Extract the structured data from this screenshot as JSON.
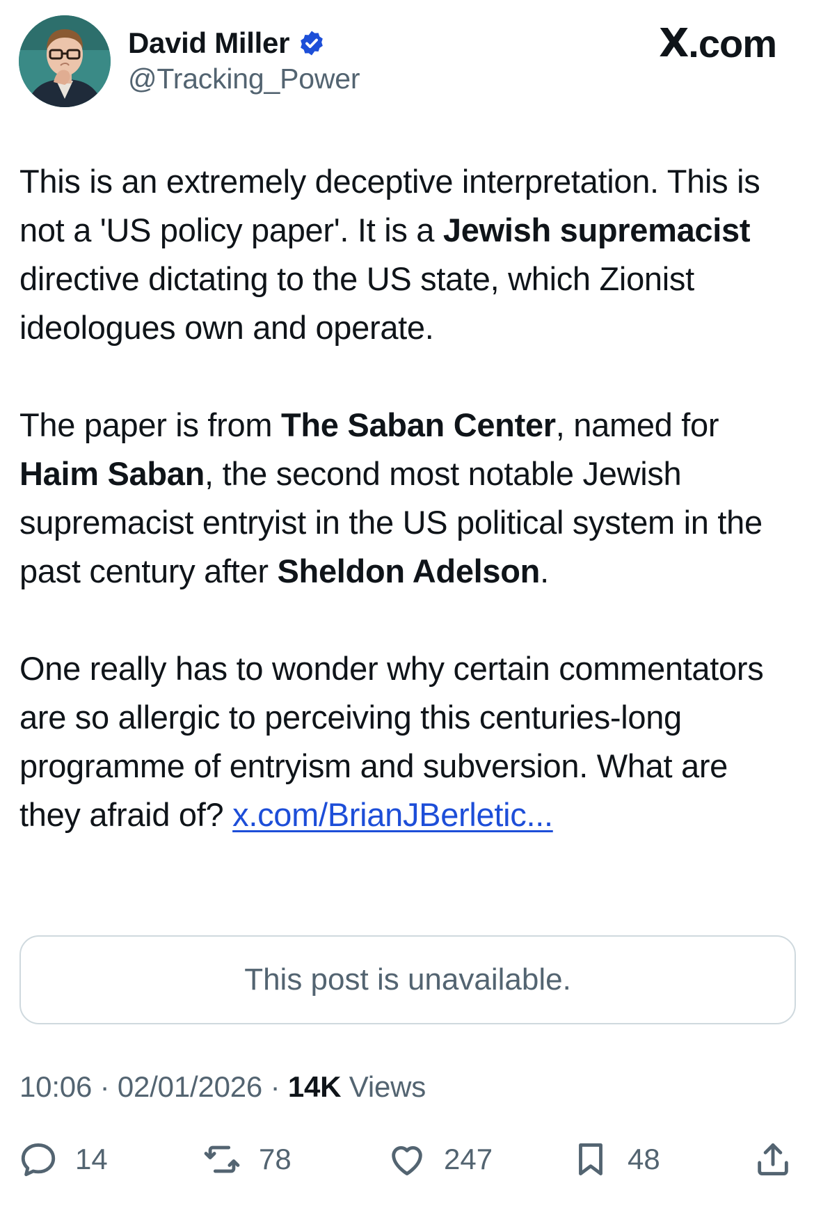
{
  "author": {
    "name": "David Miller",
    "handle": "@Tracking_Power",
    "verified": true
  },
  "site": {
    "logo_text": ".com",
    "logo_glyph": "X"
  },
  "post": {
    "p1_a": "This is an extremely deceptive interpretation. This is not a 'US policy paper'. It is a ",
    "p1_b": "Jewish supremacist",
    "p1_c": " directive dictating to the US state, which Zionist ideologues own and operate.",
    "p2_a": "The paper is from ",
    "p2_b": "The Saban Center",
    "p2_c": ", named for ",
    "p2_d": "Haim Saban",
    "p2_e": ", the second most notable Jewish supremacist entryist in the US political system in the past century after ",
    "p2_f": "Sheldon Adelson",
    "p2_g": ".",
    "p3_a": "One really has to wonder why certain commentators are so allergic to perceiving this centuries-long programme of entryism and subversion. What are they afraid of? ",
    "p3_link": "x.com/BrianJBerletic..."
  },
  "quote": {
    "text": "This post is unavailable."
  },
  "meta": {
    "time": "10:06",
    "separator": "·",
    "date": "02/01/2026",
    "views_count": "14K",
    "views_label": "Views"
  },
  "actions": {
    "replies": "14",
    "reposts": "78",
    "likes": "247",
    "bookmarks": "48"
  },
  "colors": {
    "text": "#0f1419",
    "secondary": "#536471",
    "link": "#1d4ed8",
    "verified": "#1d9bf0",
    "border": "#cfd9de"
  }
}
